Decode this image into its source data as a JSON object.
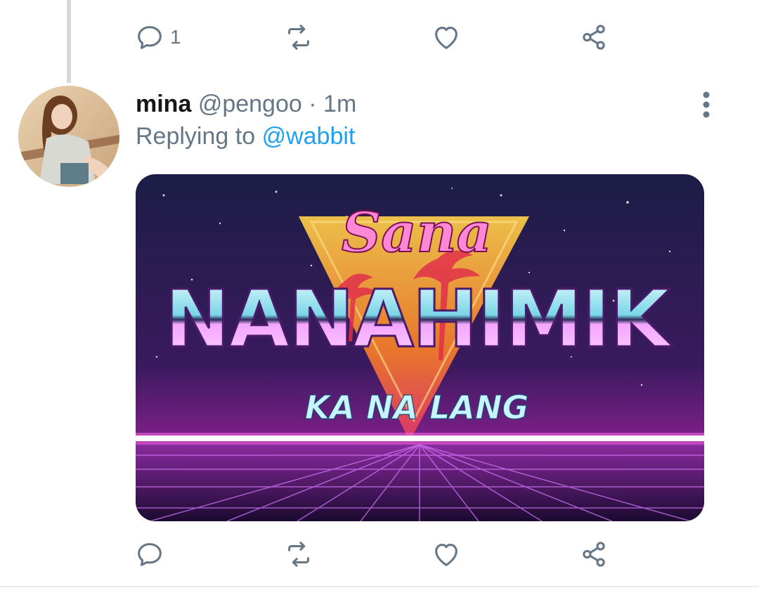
{
  "top_actions": {
    "reply_count": "1",
    "reply_icon": "reply-icon",
    "retweet_icon": "retweet-icon",
    "like_icon": "heart-icon",
    "share_icon": "share-icon"
  },
  "tweet": {
    "display_name": "mina",
    "handle": "@pengoo",
    "separator": "·",
    "time": "1m",
    "replying_prefix": "Replying to",
    "replying_to": "@wabbit",
    "menu_icon": "more-vertical-icon",
    "media": {
      "script_text": "Sana",
      "headline": "NANAHIMIK",
      "subline": "KA NA LANG"
    },
    "actions": {
      "reply_icon": "reply-icon",
      "retweet_icon": "retweet-icon",
      "like_icon": "heart-icon",
      "share_icon": "share-icon"
    }
  },
  "colors": {
    "text_primary": "#14171a",
    "text_secondary": "#657786",
    "link": "#1da1f2",
    "thread_line": "#d6d9db"
  }
}
